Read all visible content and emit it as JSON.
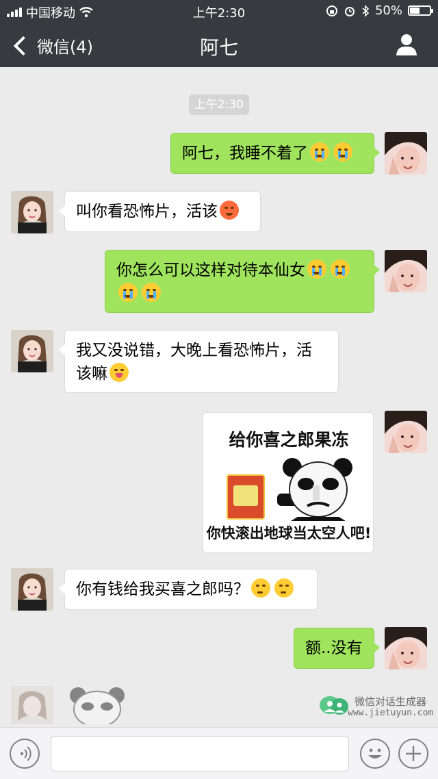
{
  "status_bar": {
    "carrier": "中国移动",
    "time": "上午2:30",
    "battery": "50%",
    "battery_level": 0.5
  },
  "nav": {
    "back_label": "微信(4)",
    "title": "阿七"
  },
  "timestamp": "上午2:30",
  "messages": [
    {
      "side": "out",
      "text": "阿七，我睡不着了",
      "emojis": [
        "crying-face",
        "crying-face"
      ]
    },
    {
      "side": "in",
      "text": "叫你看恐怖片，活该",
      "emojis": [
        "angry-face"
      ]
    },
    {
      "side": "out",
      "text": "你怎么可以这样对待本仙女",
      "emojis": [
        "crying-face",
        "crying-face",
        "crying-face",
        "crying-face"
      ]
    },
    {
      "side": "in",
      "text_line1": "我又没说错，大晚上看恐怖片，活",
      "text_line2": "该嘛",
      "emojis": [
        "tongue-wink-face"
      ]
    },
    {
      "side": "out",
      "type": "sticker",
      "top_text": "给你喜之郎果冻",
      "bottom_text": "你快滚出地球当太空人吧!"
    },
    {
      "side": "in",
      "text": "你有钱给我买喜之郎吗？",
      "emojis": [
        "thinking-face",
        "thinking-face"
      ]
    },
    {
      "side": "out",
      "text": "额..没有"
    }
  ],
  "watermark": {
    "title": "微信对话生成器",
    "url": "www.jietuyun.com"
  },
  "colors": {
    "header": "#393a3f",
    "chat_bg": "#ebebeb",
    "outgoing_bubble": "#9fe45c",
    "incoming_bubble": "#ffffff"
  }
}
